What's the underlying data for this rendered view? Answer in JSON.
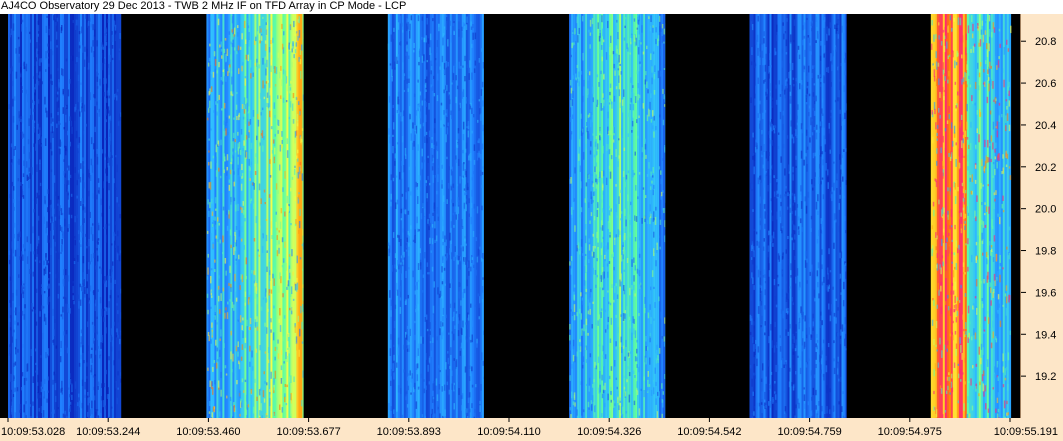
{
  "title": "AJ4CO Observatory 29 Dec 2013 - TWB 2 MHz IF on TFD Array in CP Mode - LCP",
  "chart_data": {
    "type": "heatmap",
    "title": "AJ4CO Observatory 29 Dec 2013 - TWB 2 MHz IF on TFD Array in CP Mode - LCP",
    "xlabel": "",
    "ylabel": "",
    "x_tick_labels": [
      "10:09:53.028",
      "10:09:53.244",
      "10:09:53.460",
      "10:09:53.677",
      "10:09:53.893",
      "10:09:54.110",
      "10:09:54.326",
      "10:09:54.542",
      "10:09:54.759",
      "10:09:54.975",
      "10:09:55.191"
    ],
    "y_tick_labels": [
      "19.2",
      "19.4",
      "19.6",
      "19.8",
      "20.0",
      "20.2",
      "20.4",
      "20.6",
      "20.8"
    ],
    "y_ticks": [
      19.2,
      19.4,
      19.6,
      19.8,
      20.0,
      20.2,
      20.4,
      20.6,
      20.8
    ],
    "ylim": [
      19.0,
      20.93
    ],
    "x_span_ticks": [
      0,
      10
    ],
    "colormap": [
      "#0000a0",
      "#1040d0",
      "#2080ff",
      "#30c0ff",
      "#60ffa0",
      "#ffff40",
      "#ff8000",
      "#ff2080"
    ],
    "segments": [
      {
        "start_tick": 0.0,
        "end_tick": 1.13,
        "intensity": 0.18,
        "profile": "flat"
      },
      {
        "start_tick": 1.13,
        "end_tick": 1.98,
        "intensity": 0.0,
        "profile": "gap"
      },
      {
        "start_tick": 1.98,
        "end_tick": 2.95,
        "intensity": 0.6,
        "profile": "rising"
      },
      {
        "start_tick": 2.95,
        "end_tick": 3.79,
        "intensity": 0.0,
        "profile": "gap"
      },
      {
        "start_tick": 3.79,
        "end_tick": 4.75,
        "intensity": 0.28,
        "profile": "flat"
      },
      {
        "start_tick": 4.75,
        "end_tick": 5.6,
        "intensity": 0.0,
        "profile": "gap"
      },
      {
        "start_tick": 5.6,
        "end_tick": 6.56,
        "intensity": 0.45,
        "profile": "center"
      },
      {
        "start_tick": 6.56,
        "end_tick": 7.4,
        "intensity": 0.0,
        "profile": "gap"
      },
      {
        "start_tick": 7.4,
        "end_tick": 8.37,
        "intensity": 0.22,
        "profile": "flat"
      },
      {
        "start_tick": 8.37,
        "end_tick": 9.21,
        "intensity": 0.0,
        "profile": "gap"
      },
      {
        "start_tick": 9.21,
        "end_tick": 10.0,
        "intensity": 0.75,
        "profile": "hot-left"
      }
    ]
  }
}
